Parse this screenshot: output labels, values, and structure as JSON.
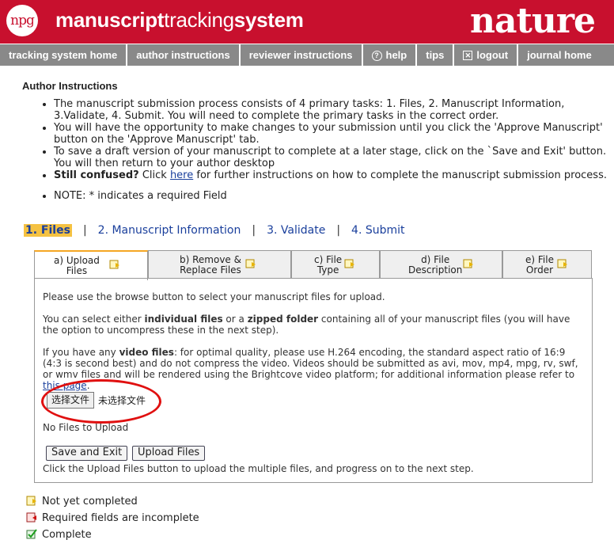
{
  "header": {
    "logo_text": "npg",
    "app_title": {
      "part1": "manuscript",
      "part2": "tracking",
      "part3": "system"
    },
    "brand": "nature"
  },
  "nav": [
    {
      "label": "tracking system home"
    },
    {
      "label": "author instructions"
    },
    {
      "label": "reviewer instructions"
    },
    {
      "label": "help",
      "icon": "help-icon"
    },
    {
      "label": "tips"
    },
    {
      "label": "logout",
      "icon": "logout-icon"
    },
    {
      "label": "journal home"
    }
  ],
  "page": {
    "title": "Author Instructions",
    "bullets": {
      "b1": "The manuscript submission process consists of 4 primary tasks: 1. Files, 2. Manuscript Information, 3.Validate, 4. Submit. You will need to complete the primary tasks in the correct order.",
      "b2": "You will have the opportunity to make changes to your submission until you click the 'Approve Manuscript' button on the 'Approve Manuscript' tab.",
      "b3": "To save a draft version of your manuscript to complete at a later stage, click on the `Save and Exit' button. You will then return to your author desktop",
      "b4_bold": "Still confused?",
      "b4_pre": " Click ",
      "b4_link": "here",
      "b4_post": " for further instructions on how to complete the manuscript submission process.",
      "b5": "NOTE: * indicates a required Field"
    }
  },
  "steps": [
    {
      "label": "1. Files",
      "active": true
    },
    {
      "label": "2. Manuscript Information"
    },
    {
      "label": "3. Validate"
    },
    {
      "label": "4. Submit"
    }
  ],
  "tabs": [
    {
      "line1": "a) Upload",
      "line2": "Files"
    },
    {
      "line1": "b) Remove &",
      "line2": "Replace Files"
    },
    {
      "line1": "c) File",
      "line2": "Type"
    },
    {
      "line1": "d) File",
      "line2": "Description"
    },
    {
      "line1": "e) File",
      "line2": "Order"
    }
  ],
  "panel": {
    "p1": "Please use the browse button to select your manuscript files for upload.",
    "p2_a": "You can select either ",
    "p2_b": "individual files",
    "p2_c": " or a ",
    "p2_d": "zipped folder",
    "p2_e": " containing all of your manuscript files (you will have the option to uncompress these in the next step).",
    "p3_a": "If you have any ",
    "p3_b": "video files",
    "p3_c": ": for optimal quality, please use H.264 encoding, the standard aspect ratio of 16:9 (4:3 is second best) and do not compress the video. Videos should be submitted as avi, mov, mp4, mpg, rv, swf, or wmv files and will be rendered using the Brightcove video platform; for additional information please refer to ",
    "p3_link": "this page",
    "p3_end": ".",
    "file_button": "选择文件",
    "file_status": "未选择文件",
    "no_files": "No Files to Upload",
    "save_exit": "Save and Exit",
    "upload": "Upload Files",
    "hint": "Click the Upload Files button to upload the multiple files, and progress on to the next step."
  },
  "legend": [
    {
      "label": "Not yet completed",
      "icon": "pending-icon"
    },
    {
      "label": "Required fields are incomplete",
      "icon": "incomplete-icon"
    },
    {
      "label": "Complete",
      "icon": "complete-icon"
    }
  ],
  "colors": {
    "brand_red": "#c8102e",
    "nav_gray": "#898989",
    "link_blue": "#1a3f9c",
    "active_step": "#f5c242"
  }
}
